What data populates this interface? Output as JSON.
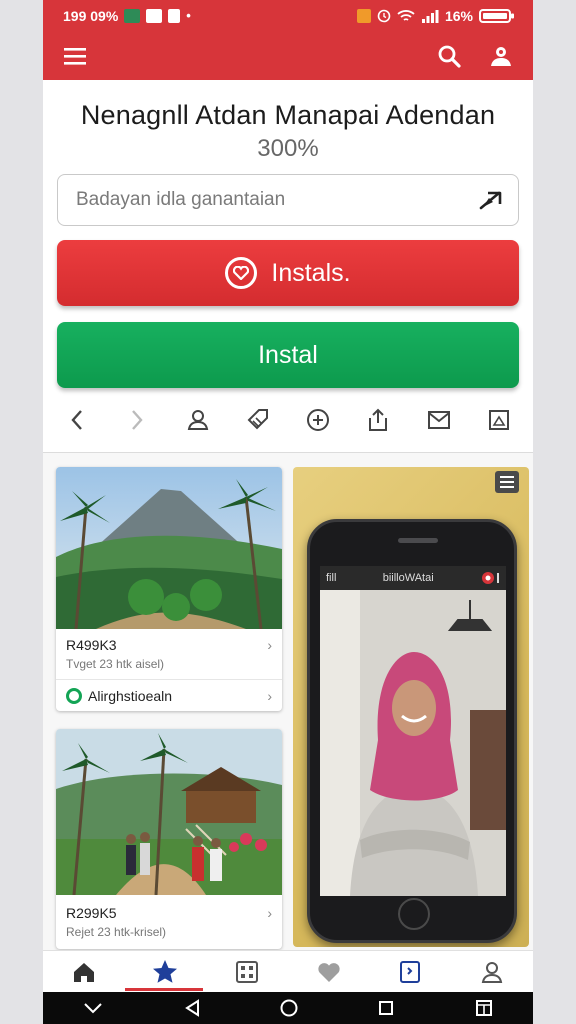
{
  "status_bar": {
    "time": "199 09%",
    "battery": "16%",
    "chip_colors": [
      "#2e8b57",
      "#ffffff",
      "#ffffff"
    ]
  },
  "app_bar": {
    "menu_icon": "hamburger-icon",
    "search_icon": "search-icon",
    "profile_icon": "account-icon"
  },
  "hero": {
    "title": "Nenagnll Atdan Manapai Adendan",
    "percent": "300%",
    "search_placeholder": "Badayan idla ganantaian",
    "primary_button": "Instals.",
    "secondary_button": "Instal"
  },
  "toolbar_icons": [
    "chevron-left-icon",
    "chevron-right-icon",
    "person-icon",
    "tag-icon",
    "add-circle-icon",
    "share-icon",
    "mail-icon",
    "image-icon"
  ],
  "cards": [
    {
      "title": "R499K3",
      "subtitle": "Tvget 23 htk aisel)",
      "location": "Alirghstioealn"
    },
    {
      "title": "R299K5",
      "subtitle": "Rejet 23 htk-krisel)"
    }
  ],
  "promo": {
    "inner_status": "fill",
    "inner_app_title": "biilloWAtai"
  },
  "bottom_nav": [
    "home-icon",
    "star-icon",
    "grid-icon",
    "heart-icon",
    "bookmark-icon",
    "profile-icon"
  ],
  "colors": {
    "brand_red": "#d7353a",
    "install_green": "#11a556",
    "nav_active": "#1f3f9a"
  }
}
